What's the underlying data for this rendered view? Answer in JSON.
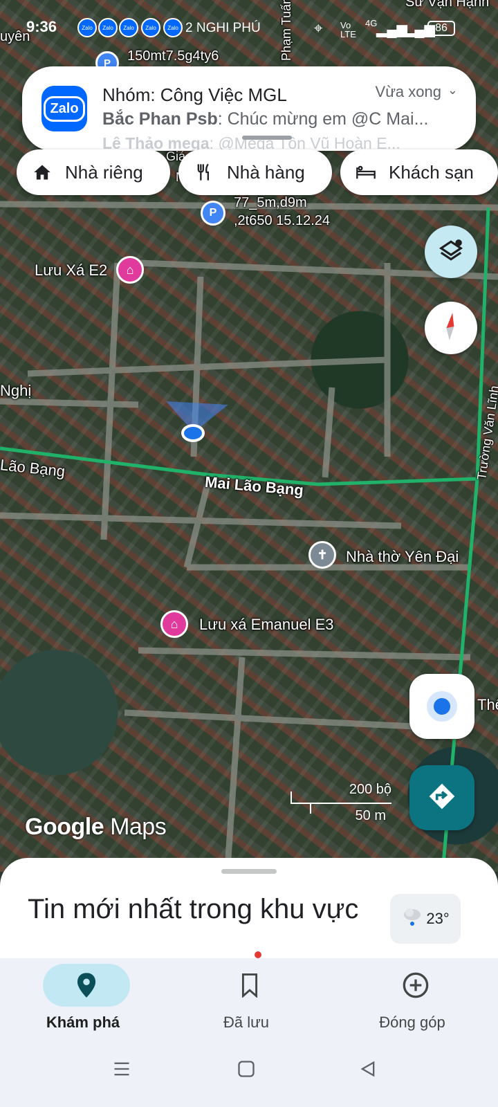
{
  "status_bar": {
    "time": "9:36",
    "carrier_text": "2 NGHI PHÚ",
    "network": "Vo LTE",
    "network_type": "4G",
    "battery": "86",
    "zalo_badge": "Zalo"
  },
  "notification": {
    "app": "Zalo",
    "title": "Nhóm: Công Việc MGL",
    "time": "Vừa xong",
    "sender": "Bắc Phan Psb",
    "message": ": Chúc mừng em @C Mai...",
    "sender2": "Lê Thảo mega",
    "message2": ": @Mega Tôn Vũ Hoàn E..."
  },
  "chips": [
    {
      "label": "Nhà riêng",
      "icon": "home-icon"
    },
    {
      "label": "Nhà hàng",
      "icon": "restaurant-icon"
    },
    {
      "label": "Khách sạn",
      "icon": "hotel-icon"
    }
  ],
  "map": {
    "labels": {
      "street_top": "Phạm Tuấn",
      "place_top_right": "Sư Vạn Hạnh",
      "place_top_left": "uyên",
      "pin_note_1": "150mt7.5g4ty6",
      "pin_note_2a": "77_5m,d9m",
      "pin_note_2b": ",2t650 15.12.24",
      "hidden_1": "Giá",
      "hidden_2": "N",
      "luu_xa_e2": "Lưu Xá E2",
      "nghi": "Nghị",
      "lao_bang_left": "Lão Bạng",
      "mai_lao_bang": "Mai Lão Bạng",
      "truong_van_linh": "Trường Văn Lĩnh",
      "nha_tho": "Nhà thờ Yên Đại",
      "luu_xa_e3": "Lưu xá Emanuel E3",
      "the": "Thế"
    },
    "scale": {
      "top": "200 bộ",
      "bottom": "50 m"
    },
    "logo_google": "Google",
    "logo_maps": "Maps"
  },
  "controls": {
    "layers": "layers-icon",
    "compass": "compass-icon",
    "location": "my-location-icon",
    "directions": "directions-icon"
  },
  "bottom_sheet": {
    "heading": "Tin mới nhất trong khu vực",
    "weather_temp": "23°"
  },
  "bottom_nav": [
    {
      "label": "Khám phá",
      "icon": "explore-pin-icon",
      "active": true
    },
    {
      "label": "Đã lưu",
      "icon": "bookmark-icon",
      "active": false
    },
    {
      "label": "Đóng góp",
      "icon": "add-circle-icon",
      "active": false
    }
  ],
  "colors": {
    "accent_teal": "#0b7480",
    "nav_active_pill": "#c2e9f3",
    "road_green": "#21b26a",
    "poi_pink": "#e13a9d",
    "location_blue": "#1a73e8"
  }
}
